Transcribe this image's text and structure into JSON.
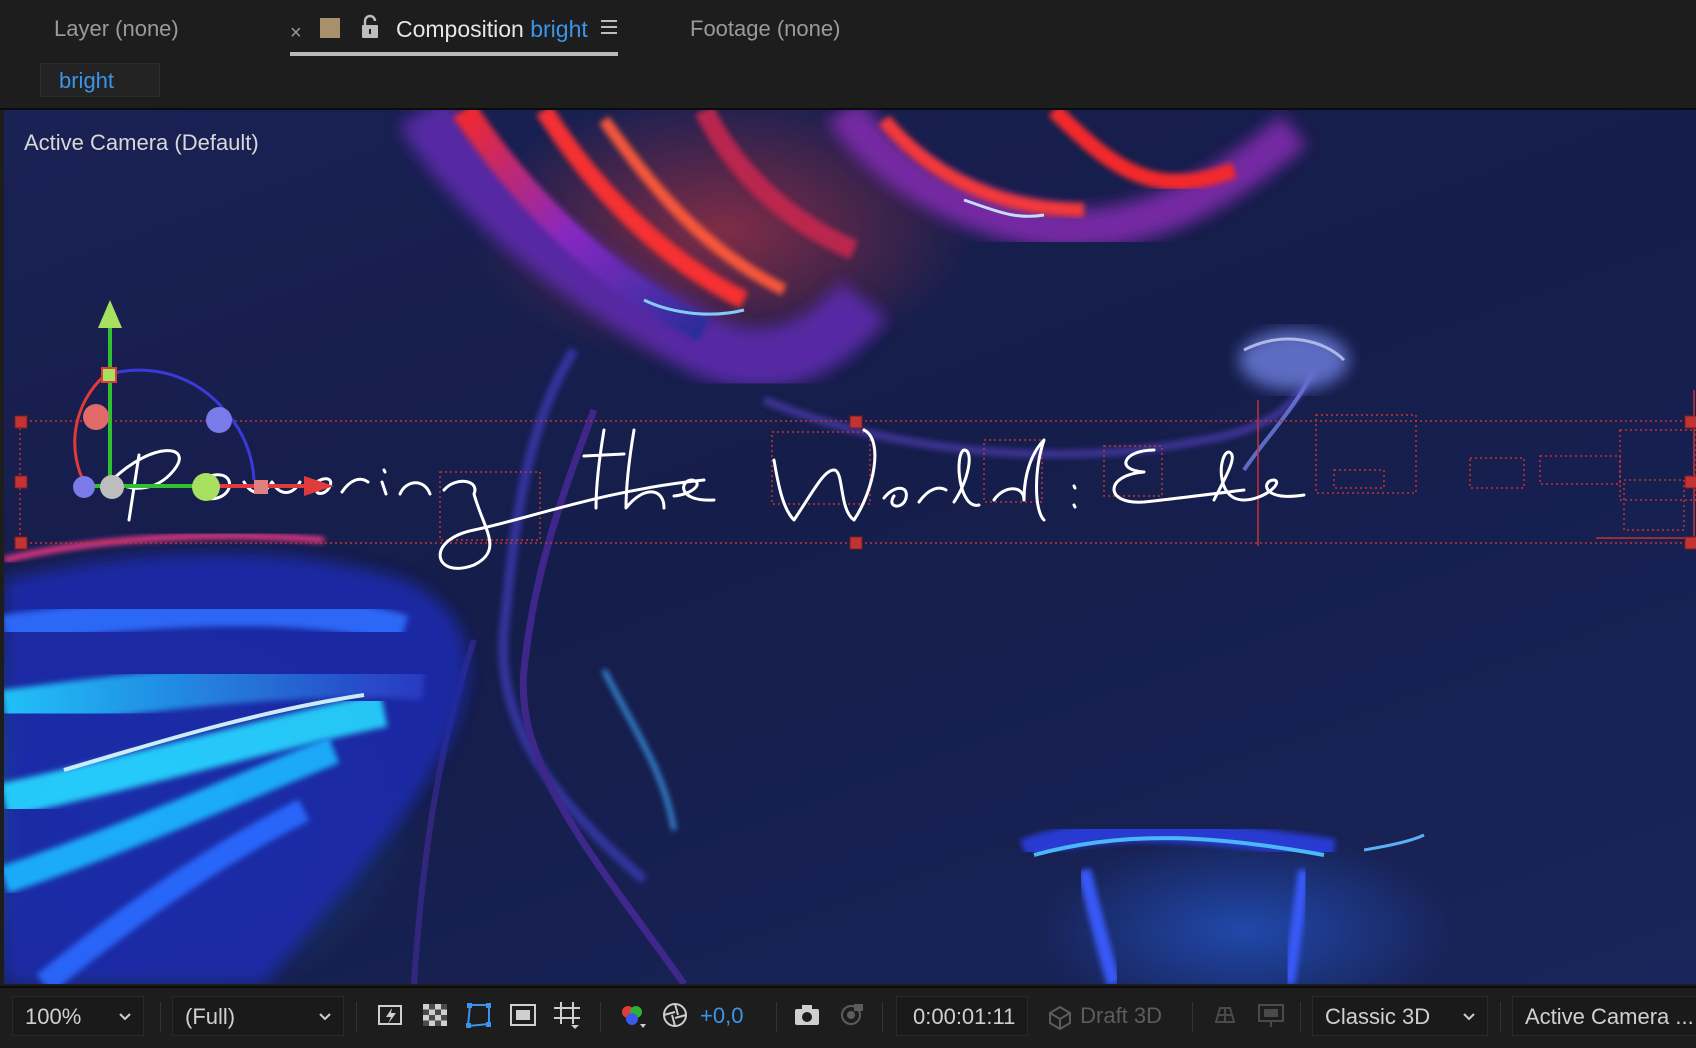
{
  "tabs": {
    "layer": "Layer (none)",
    "comp_prefix": "Composition",
    "comp_name": "bright",
    "footage": "Footage (none)",
    "close_glyph": "×"
  },
  "breadcrumb": {
    "label": "bright"
  },
  "viewer": {
    "camera_label": "Active Camera (Default)",
    "text_layer_content": "Powering the World: Ele"
  },
  "toolbar": {
    "zoom": "100%",
    "resolution": "(Full)",
    "exposure": "+0,0",
    "timecode": "0:00:01:11",
    "draft3d": "Draft 3D",
    "renderer": "Classic 3D",
    "view": "Active Camera ..."
  },
  "colors": {
    "accent": "#3a95ea",
    "label_swatch": "#a8906c",
    "handle": "#e03a3a"
  },
  "icons": [
    "close-icon",
    "label-swatch",
    "lock-icon",
    "panel-menu-icon",
    "chevron-down-icon",
    "fast-previews-icon",
    "transparency-grid-icon",
    "mask-visibility-icon",
    "region-of-interest-icon",
    "grid-guides-icon",
    "channel-icon",
    "exposure-icon",
    "snapshot-icon",
    "show-snapshot-icon",
    "draft3d-icon",
    "3d-ground-plane-icon",
    "extended-viewer-icon"
  ]
}
